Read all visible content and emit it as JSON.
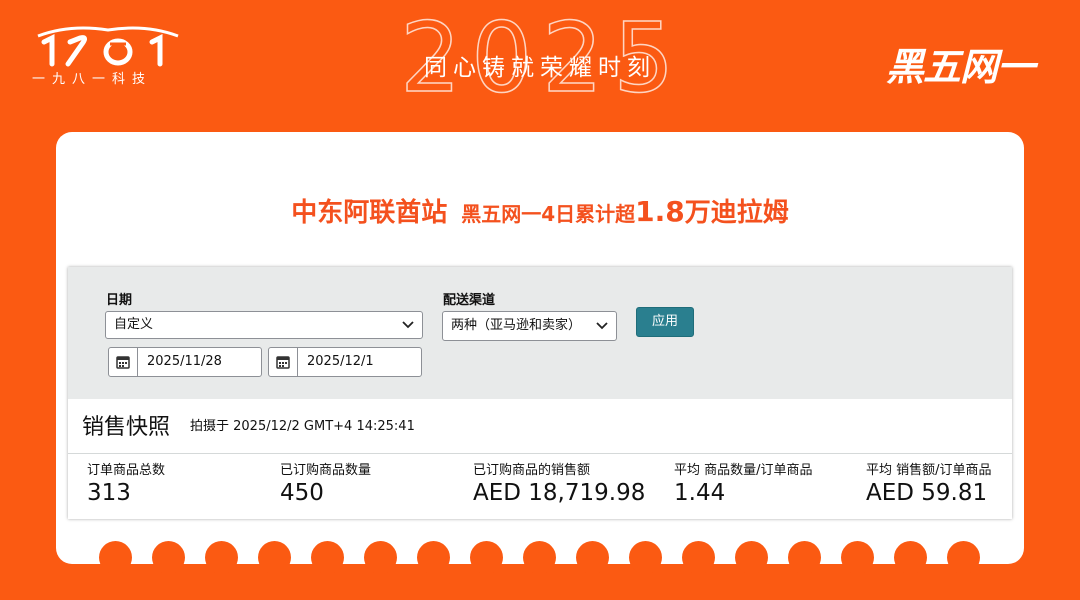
{
  "brand": {
    "logo_text": "1981",
    "subtitle": "一九八一科技",
    "year": "2025",
    "slogan": "同心铸就荣耀时刻",
    "event_badge": "黑五网一"
  },
  "headline": {
    "part1": "中东阿联酋站",
    "part2": "黑五网一4日累计超",
    "part3": "1.8",
    "part4": "万迪拉姆"
  },
  "filters": {
    "date_label": "日期",
    "date_select_value": "自定义",
    "start_date": "2025/11/28",
    "end_date": "2025/12/1",
    "channel_label": "配送渠道",
    "channel_select_value": "两种（亚马逊和卖家）",
    "apply_label": "应用"
  },
  "snapshot": {
    "title": "销售快照",
    "captured_at": "拍摄于 2025/12/2 GMT+4 14:25:41",
    "metrics": [
      {
        "label": "订单商品总数",
        "value": "313"
      },
      {
        "label": "已订购商品数量",
        "value": "450"
      },
      {
        "label": "已订购商品的销售额",
        "value": "AED 18,719.98"
      },
      {
        "label": "平均 商品数量/订单商品",
        "value": "1.44"
      },
      {
        "label": "平均 销售额/订单商品",
        "value": "AED 59.81"
      }
    ]
  },
  "colors": {
    "brand_orange": "#fb5a12",
    "headline_orange": "#f4511e",
    "apply_button": "#2a7f8f",
    "filter_bg": "#e8eaea"
  },
  "icons": {
    "calendar": "calendar-icon",
    "dropdown": "chevron-down-icon"
  }
}
